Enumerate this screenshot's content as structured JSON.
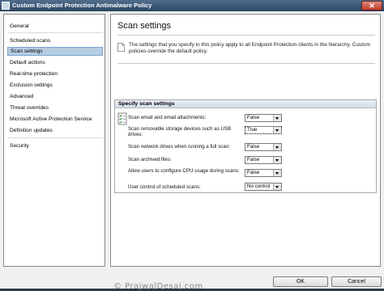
{
  "window": {
    "title": "Custom Endpoint Protection Antimalware Policy",
    "close_glyph": "✕"
  },
  "nav": {
    "items": [
      {
        "label": "General"
      },
      {
        "label": "Scheduled scans"
      },
      {
        "label": "Scan settings"
      },
      {
        "label": "Default actions"
      },
      {
        "label": "Real-time protection"
      },
      {
        "label": "Exclusion settings"
      },
      {
        "label": "Advanced"
      },
      {
        "label": "Threat overrides"
      },
      {
        "label": "Microsoft Active Protection Service"
      },
      {
        "label": "Definition updates"
      },
      {
        "label": "Security"
      }
    ],
    "selected": "Scan settings"
  },
  "main": {
    "title": "Scan settings",
    "description": "The settings that you specify in this policy apply to all Endpoint Protection clients in the hierarchy. Custom policies override the default policy.",
    "section_title": "Specify scan settings",
    "settings": [
      {
        "label": "Scan email and email attachments:",
        "value": "False"
      },
      {
        "label": "Scan removable storage devices such as USB drives:",
        "value": "True"
      },
      {
        "label": "Scan network drives when running a full scan:",
        "value": "False"
      },
      {
        "label": "Scan archived files:",
        "value": "False"
      },
      {
        "label": "Allow users to configure CPU usage during scans:",
        "value": "False"
      },
      {
        "label": "User control of scheduled scans:",
        "value": "No control"
      }
    ]
  },
  "footer": {
    "watermark": "© PrajwalDesai.com",
    "ok_label": "OK",
    "cancel_label": "Cancel"
  },
  "colors": {
    "titlebar": "#2c4662",
    "selected_nav": "#b7cde4"
  }
}
